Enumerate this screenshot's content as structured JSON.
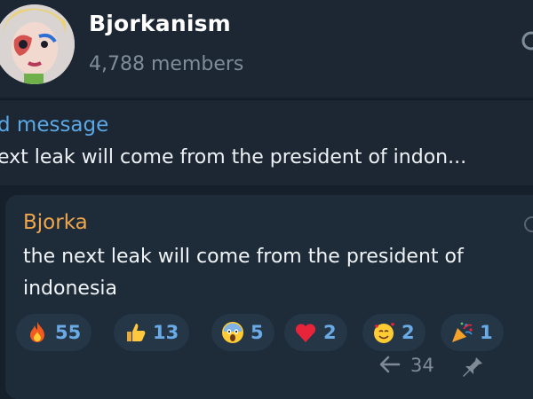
{
  "channel": {
    "name": "Bjorkanism",
    "members": "4,788 members",
    "avatar_icon": "avatar-image"
  },
  "pinned": {
    "label": "d message",
    "text": "ext leak will come from the president of indon..."
  },
  "message": {
    "sender": "Bjorka",
    "line1": "the next leak will come from the president of",
    "line2": "indonesia",
    "forward_count": "34"
  },
  "reactions": [
    {
      "icon": "fire-icon",
      "count": "55"
    },
    {
      "icon": "thumbs-up-icon",
      "count": "13"
    },
    {
      "icon": "screaming-face-icon",
      "count": "5"
    },
    {
      "icon": "heart-icon",
      "count": "2"
    },
    {
      "icon": "smiling-hearts-face-icon",
      "count": "2"
    },
    {
      "icon": "party-popper-icon",
      "count": "1"
    }
  ],
  "colors": {
    "background": "#15202b",
    "header": "#1c2733",
    "bubble": "#1e2c3a",
    "chip": "#253647",
    "accent": "#5aa9e6",
    "sender": "#f0a64a",
    "muted": "#7f8c99"
  }
}
